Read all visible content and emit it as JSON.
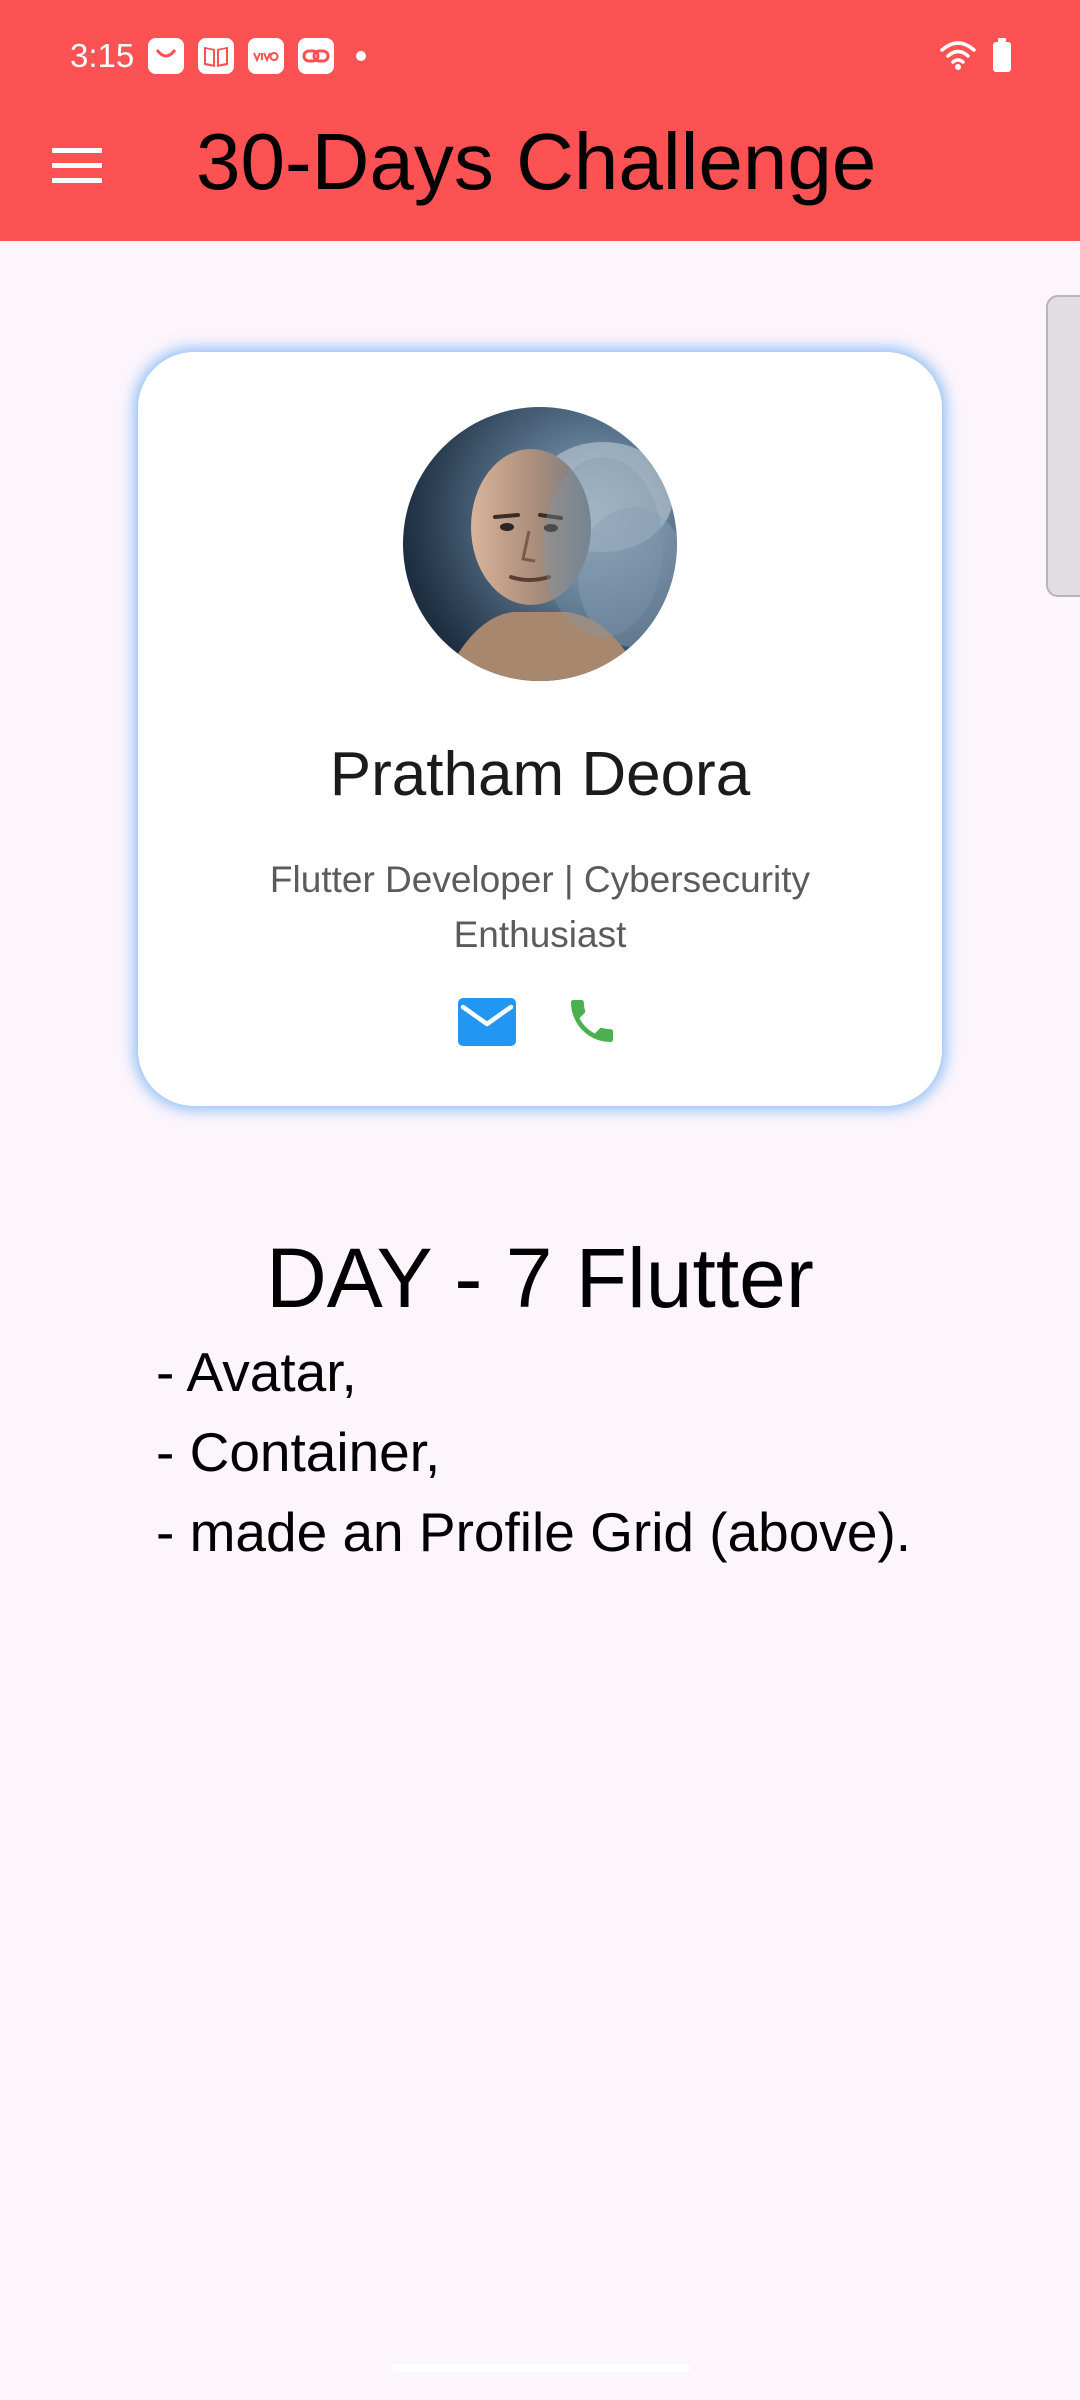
{
  "status_bar": {
    "time": "3:15",
    "icons": [
      "shopping-bag-icon",
      "book-icon",
      "vivo-icon",
      "link-icon",
      "dot-icon",
      "wifi-icon",
      "battery-icon"
    ]
  },
  "app_bar": {
    "title": "30-Days Challenge",
    "menu_icon": "hamburger-menu-icon",
    "background": "#fd5253"
  },
  "profile_card": {
    "name": "Pratham Deora",
    "subtitle": "Flutter Developer | Cybersecurity Enthusiast",
    "contact_icons": [
      "email-icon",
      "phone-icon"
    ],
    "email_icon_color": "#2196f3",
    "phone_icon_color": "#4caf50",
    "glow_color": "#63aaf5"
  },
  "content": {
    "day_title": "DAY - 7 Flutter",
    "notes": [
      "- Avatar,",
      "- Container,",
      "- made an Profile Grid (above)."
    ]
  },
  "colors": {
    "page_background": "#fcf5fc",
    "title_text": "#000000"
  }
}
